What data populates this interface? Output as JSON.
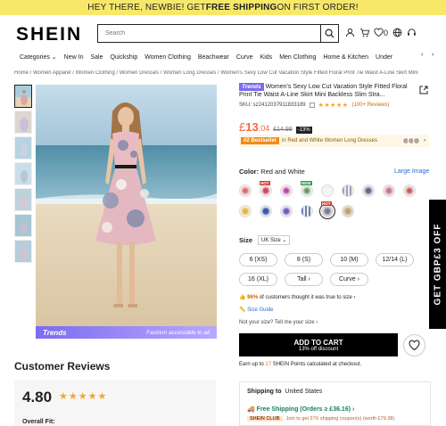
{
  "promo": {
    "part1": "HEY THERE, NEWBIE! GET ",
    "bold": "FREE SHIPPING",
    "part2": " ON FIRST ORDER!"
  },
  "header": {
    "logo": "SHEIN",
    "search_placeholder": "Search",
    "wishlist_count": "0"
  },
  "nav": {
    "items": [
      "Categories",
      "New In",
      "Sale",
      "Quickship",
      "Women Clothing",
      "Beachwear",
      "Curve",
      "Kids",
      "Men Clothing",
      "Home & Kitchen",
      "Under"
    ]
  },
  "breadcrumb": "Home / Women Apparel / Women Clothing / Women Dresses / Women Long Dresses / Women's Sexy Low Cut Vacation Style Fitted Floral Print Tie Waist A-Line Skirt Mini",
  "gallery": {
    "trends_label": "Trends",
    "trends_tagline": "Fashion accessible to all"
  },
  "product": {
    "trend_tag": "Trends",
    "title": "Women's Sexy Low Cut Vacation Style Fitted Floral Print Tie Waist A-Line Skirt Mini Backless Slim Stra...",
    "sku": "SKU: sz2412037911833189",
    "stars": "★★★★★",
    "reviews": "(100+ Reviews)",
    "price_symbol": "£",
    "price_main": "13",
    "price_cents": ".04",
    "old_price": "£14.99",
    "discount": "-13%",
    "bestseller_badge": "#2 Bestseller",
    "bestseller_text": "in Red and White Women Long Dresses",
    "color_label": "Color:",
    "color_value": "Red and White",
    "large_image": "Large Image",
    "swatch_hot": "HOT",
    "swatch_new": "NEW",
    "size_label": "Size",
    "size_system": "UK Size",
    "sizes": [
      "6 (XS)",
      "8 (S)",
      "10 (M)",
      "12/14 (L)",
      "16 (XL)",
      "Tall",
      "Curve"
    ],
    "truefit_pct": "96%",
    "truefit_text": " of customers thought it was true to size ›",
    "size_guide": "Size Guide",
    "not_sure": "Not your size? Tell me your size ›",
    "add_to_cart": "ADD TO CART",
    "add_to_cart_sub": "13% off discount",
    "points_pre": "Earn up to ",
    "points_num": "17",
    "points_post": " SHEIN Points calculated at checkout."
  },
  "reviews": {
    "title": "Customer Reviews",
    "rating": "4.80",
    "stars": "★★★★★",
    "overall_fit": "Overall Fit:"
  },
  "shipping": {
    "to_label": "Shipping to",
    "to_value": "United States",
    "free": "Free Shipping (Orders ≥ £36.16)",
    "club_badge": "SHEIN CLUB",
    "club_text": "Join to get 27X shipping coupon(s) (worth £79.38)."
  },
  "side_banner": "GET GBP£3 OFF"
}
